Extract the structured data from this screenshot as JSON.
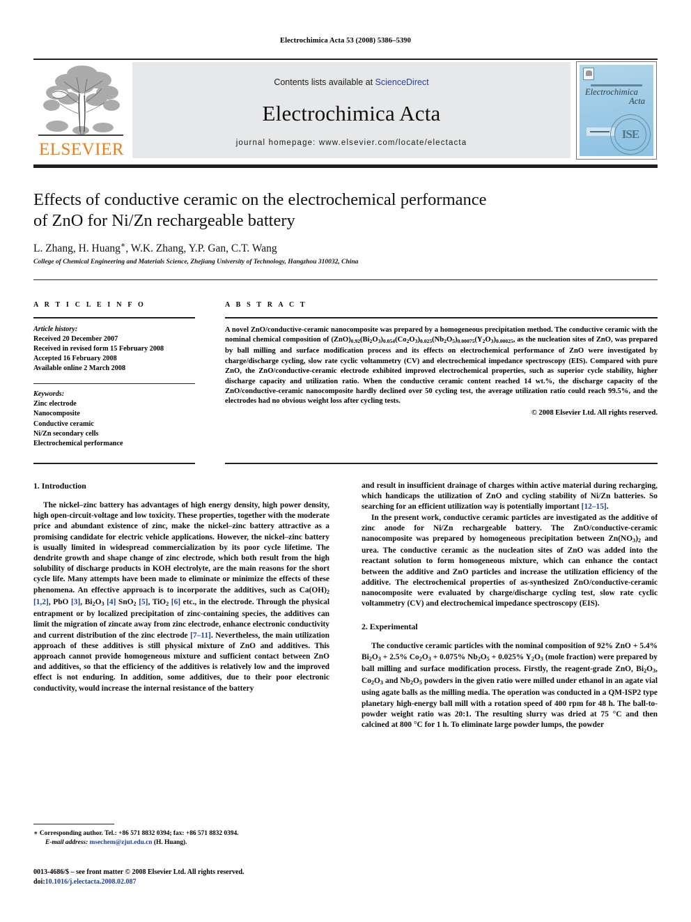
{
  "running_head": "Electrochimica Acta 53 (2008) 5386–5390",
  "masthead": {
    "contents_text": "Contents lists available at ",
    "sciencedirect": "ScienceDirect",
    "journal_name": "Electrochimica Acta",
    "homepage": "journal homepage: www.elsevier.com/locate/electacta",
    "publisher_wordmark": "ELSEVIER",
    "cover_title_line1": "Electrochimica",
    "cover_title_line2": "Acta",
    "cover_society": "ISE",
    "sciencedirect_color": "#2740a8",
    "elsevier_orange": "#ec8015",
    "band_gray": "#e7e8e9"
  },
  "article": {
    "title_line1": "Effects of conductive ceramic on the electrochemical performance",
    "title_line2": "of ZnO for Ni/Zn rechargeable battery",
    "authors": "L. Zhang, H. Huang",
    "authors_tail": ", W.K. Zhang, Y.P. Gan, C.T. Wang",
    "corresponding_marker": "∗",
    "affiliation": "College of Chemical Engineering and Materials Science, Zhejiang University of Technology, Hangzhou 310032, China"
  },
  "article_info": {
    "heading": "A R T I C L E   I N F O",
    "history_label": "Article history:",
    "history": [
      "Received 20 December 2007",
      "Received in revised form 15 February 2008",
      "Accepted 16 February 2008",
      "Available online 2 March 2008"
    ],
    "keywords_label": "Keywords:",
    "keywords": [
      "Zinc electrode",
      "Nanocomposite",
      "Conductive ceramic",
      "Ni/Zn secondary cells",
      "Electrochemical performance"
    ]
  },
  "abstract": {
    "heading": "A B S T R A C T",
    "part1": "A novel ZnO/conductive-ceramic nanocomposite was prepared by a homogeneous precipitation method. The conductive ceramic with the nominal chemical composition of ",
    "formula": {
      "segments": [
        {
          "base": "(ZnO)",
          "sub": "0.92"
        },
        {
          "base": "(Bi",
          "sub": "2"
        },
        {
          "base": "O",
          "sub": "3"
        },
        {
          "base": ")",
          "sub": "0.054"
        },
        {
          "base": "(Co",
          "sub": "2"
        },
        {
          "base": "O",
          "sub": "3"
        },
        {
          "base": ")",
          "sub": "0.025"
        },
        {
          "base": "(Nb",
          "sub": "2"
        },
        {
          "base": "O",
          "sub": "5"
        },
        {
          "base": ")",
          "sub": "0.00075"
        },
        {
          "base": "(Y",
          "sub": "2"
        },
        {
          "base": "O",
          "sub": "3"
        },
        {
          "base": ")",
          "sub": "0.00025"
        }
      ],
      "plain": "(ZnO)0.92(Bi2O3)0.054(Co2O3)0.025(Nb2O5)0.00075(Y2O3)0.00025"
    },
    "part2": ", as the nucleation sites of ZnO, was prepared by ball milling and surface modification process and its effects on electrochemical performance of ZnO were investigated by charge/discharge cycling, slow rate cyclic voltammetry (CV) and electrochemical impedance spectroscopy (EIS). Compared with pure ZnO, the ZnO/conductive-ceramic electrode exhibited improved electrochemical properties, such as superior cycle stability, higher discharge capacity and utilization ratio. When the conductive ceramic content reached 14 wt.%, the discharge capacity of the ZnO/conductive-ceramic nanocomposite hardly declined over 50 cycling test, the average utilization ratio could reach 99.5%, and the electrodes had no obvious weight loss after cycling tests.",
    "copyright": "© 2008 Elsevier Ltd. All rights reserved."
  },
  "sections": {
    "introduction_heading": "1.  Introduction",
    "experimental_heading": "2.  Experimental",
    "intro_p1a": "The nickel–zinc battery has advantages of high energy density, high power density, high open-circuit-voltage and low toxicity. These properties, together with the moderate price and abundant existence of zinc, make the nickel–zinc battery attractive as a promising candidate for electric vehicle applications. However, the nickel–zinc battery is usually limited in widespread commercialization by its poor cycle lifetime. The dendrite growth and shape change of zinc electrode, which both result from the high solubility of discharge products in KOH electrolyte, are the main reasons for the short cycle life. Many attempts have been made to eliminate or minimize the effects of these phenomena. An effective approach is to incorporate the additives, such as Ca(OH)",
    "intro_cite1": "[1,2]",
    "intro_frag1": ", PbO ",
    "intro_cite2": "[3]",
    "intro_frag2": ", Bi",
    "intro_cite3": "[4]",
    "intro_frag3": " SnO",
    "intro_cite4": "[5]",
    "intro_frag4": ", TiO",
    "intro_cite5": "[6]",
    "intro_frag5": " etc., in the electrode. Through the physical entrapment or by localized precipitation of zinc-containing species, the additives can limit the migration of zincate away from zinc electrode, enhance electronic conductivity and current distribution of the zinc electrode ",
    "intro_cite6": "[7–11]",
    "intro_frag6": ". Nevertheless, the main utilization approach of these additives is still physical mixture of ZnO and additives. This approach cannot provide homogeneous mixture and sufficient contact between ZnO and additives, so that the efficiency of the additives is relatively low and the improved effect is not enduring. In addition, some additives, due to their poor electronic conductivity, would increase the internal resistance of the battery",
    "intro_p2a": "and result in insufficient drainage of charges within active material during recharging, which handicaps the utilization of ZnO and cycling stability of Ni/Zn batteries. So searching for an efficient utilization way is potentially important ",
    "intro_cite7": "[12–15]",
    "intro_p2b": ".",
    "intro_p3a": "In the present work, conductive ceramic particles are investigated as the additive of zinc anode for Ni/Zn rechargeable battery. The ZnO/conductive-ceramic nanocomposite was prepared by homogeneous precipitation between Zn(NO",
    "intro_p3b": " and urea. The conductive ceramic as the nucleation sites of ZnO was added into the reactant solution to form homogeneous mixture, which can enhance the contact between the additive and ZnO particles and increase the utilization efficiency of the additive. The electrochemical properties of as-synthesized ZnO/conductive-ceramic nanocomposite were evaluated by charge/discharge cycling test, slow rate cyclic voltammetry (CV) and electrochemical impedance spectroscopy (EIS).",
    "exp_p1a": "The conductive ceramic particles with the nominal composition of 92% ZnO + 5.4% Bi",
    "exp_p1b": " + 2.5% Co",
    "exp_p1c": " + 0.075% Nb",
    "exp_p1d": " + 0.025% Y",
    "exp_p1e": " (mole fraction) were prepared by ball milling and surface modification process. Firstly, the reagent-grade ZnO, Bi",
    "exp_p1f": ", Co",
    "exp_p1g": " and Nb",
    "exp_p1h": " powders in the given ratio were milled under ethanol in an agate vial using agate balls as the milling media. The operation was conducted in a QM-ISP2 type planetary high-energy ball mill with a rotation speed of 400 rpm for 48 h. The ball-to-powder weight ratio was 20:1. The resulting slurry was dried at 75 °C and then calcined at 800 °C for 1 h. To eliminate large powder lumps, the powder"
  },
  "footnote": {
    "marker": "∗",
    "corresponding": " Corresponding author. Tel.: +86 571 8832 0394; fax: +86 571 8832 0394.",
    "email_label": "E-mail address:",
    "email": "msechem@zjut.edu.cn",
    "email_owner": " (H. Huang)."
  },
  "imprint": {
    "issn_line": "0013-4686/$ – see front matter © 2008 Elsevier Ltd. All rights reserved.",
    "doi_label": "doi:",
    "doi": "10.1016/j.electacta.2008.02.087"
  }
}
